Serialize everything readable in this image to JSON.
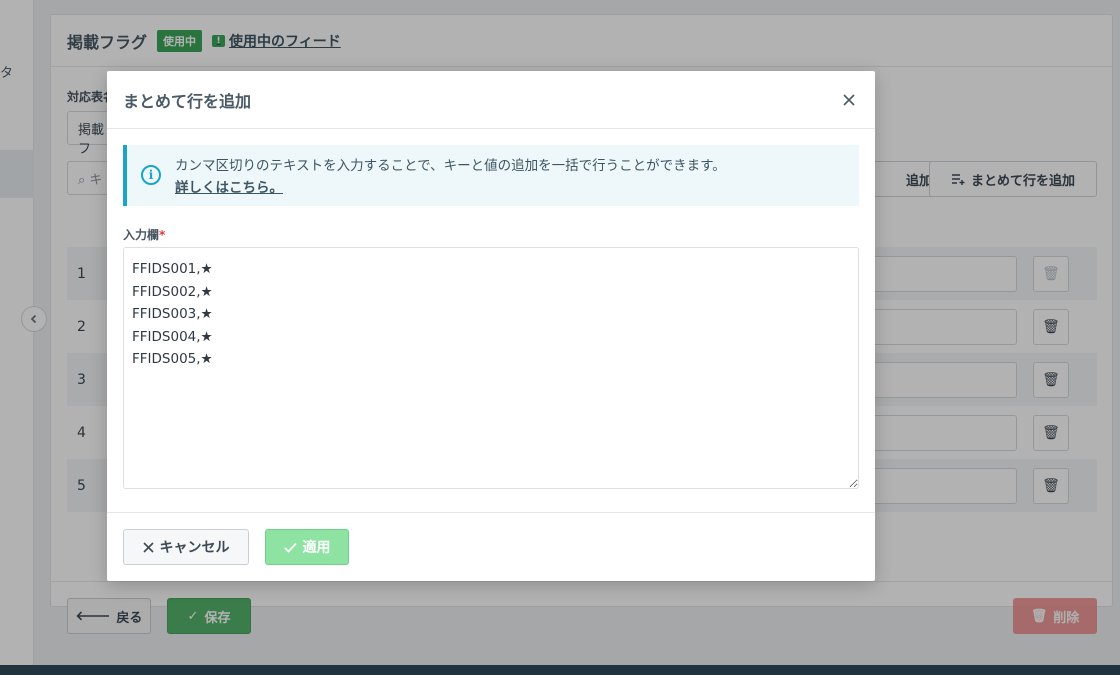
{
  "background": {
    "sidebar_fragment": "タ",
    "card_title": "掲載フラグ",
    "status_badge": "使用中",
    "feed_link": "使用中のフィード",
    "select_label": "対応表名",
    "select_value": "掲載フ",
    "search_fragment": "キ",
    "add_row_fragment": "追加",
    "bulk_add_label": "まとめて行を追加",
    "rows": [
      {
        "num": "1"
      },
      {
        "num": "2"
      },
      {
        "num": "3"
      },
      {
        "num": "4"
      },
      {
        "num": "5"
      }
    ],
    "back_label": "戻る",
    "save_label": "保存",
    "delete_label": "削除"
  },
  "modal": {
    "title": "まとめて行を追加",
    "info_text": "カンマ区切りのテキストを入力することで、キーと値の追加を一括で行うことができます。",
    "info_link": "詳しくはこちら。",
    "input_label": "入力欄",
    "required_mark": "*",
    "textarea_value": "FFIDS001,★\nFFIDS002,★\nFFIDS003,★\nFFIDS004,★\nFFIDS005,★",
    "cancel_label": "キャンセル",
    "apply_label": "適用"
  },
  "colors": {
    "accent_info": "#1aa4c8",
    "success": "#3aa55a",
    "apply_disabled": "#8ee3a2",
    "danger": "#f08a8a"
  }
}
